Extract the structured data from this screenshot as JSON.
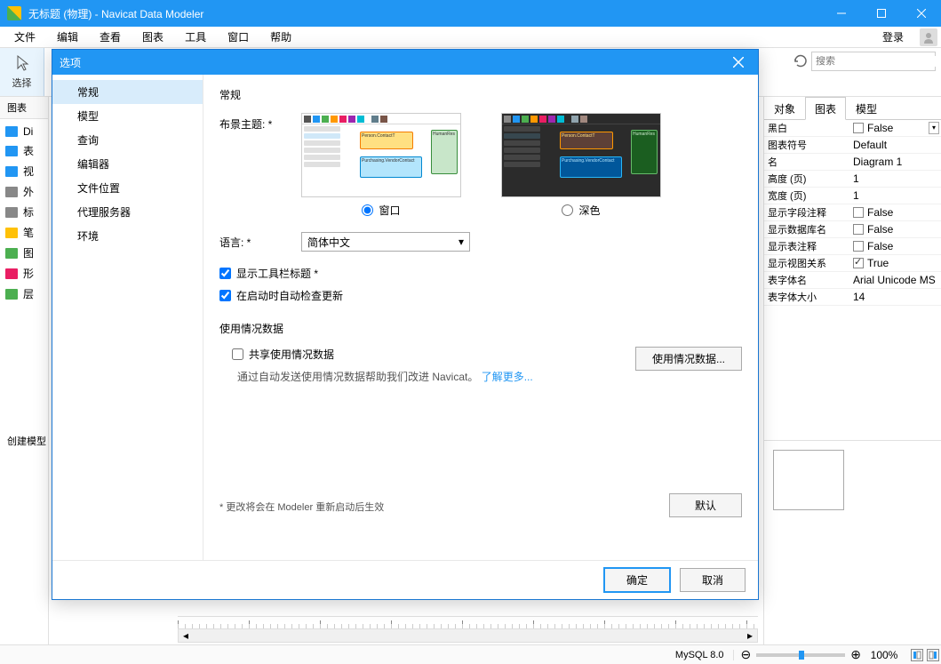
{
  "window": {
    "title": "无标题 (物理) - Navicat Data Modeler"
  },
  "menu": {
    "file": "文件",
    "edit": "编辑",
    "view": "查看",
    "diagram": "图表",
    "tools": "工具",
    "window": "窗口",
    "help": "帮助",
    "login": "登录"
  },
  "toolbar": {
    "select_label": "选择",
    "search_placeholder": "搜索"
  },
  "left_panel": {
    "tab": "图表",
    "items": [
      {
        "label": "Di",
        "color": "#2196F3"
      },
      {
        "label": "表",
        "color": "#2196F3"
      },
      {
        "label": "视",
        "color": "#2196F3"
      },
      {
        "label": "外",
        "color": "#888"
      },
      {
        "label": "标",
        "color": "#888"
      },
      {
        "label": "笔",
        "color": "#FFC107"
      },
      {
        "label": "图",
        "color": "#4CAF50"
      },
      {
        "label": "形",
        "color": "#E91E63"
      },
      {
        "label": "层",
        "color": "#4CAF50"
      }
    ],
    "create_model": "创建模型"
  },
  "right_panel": {
    "tabs": {
      "object": "对象",
      "diagram": "图表",
      "model": "模型"
    },
    "props": [
      {
        "key": "黑白",
        "val": "False",
        "cb": true,
        "checked": false,
        "dd": true
      },
      {
        "key": "图表符号",
        "val": "Default"
      },
      {
        "key": "名",
        "val": "Diagram 1"
      },
      {
        "key": "高度 (页)",
        "val": "1"
      },
      {
        "key": "宽度 (页)",
        "val": "1"
      },
      {
        "key": "显示字段注释",
        "val": "False",
        "cb": true,
        "checked": false
      },
      {
        "key": "显示数据库名",
        "val": "False",
        "cb": true,
        "checked": false
      },
      {
        "key": "显示表注释",
        "val": "False",
        "cb": true,
        "checked": false
      },
      {
        "key": "显示视图关系",
        "val": "True",
        "cb": true,
        "checked": true
      },
      {
        "key": "表字体名",
        "val": "Arial Unicode MS"
      },
      {
        "key": "表字体大小",
        "val": "14"
      }
    ]
  },
  "dialog": {
    "title": "选项",
    "nav": {
      "general": "常规",
      "model": "模型",
      "query": "查询",
      "editor": "编辑器",
      "file_loc": "文件位置",
      "proxy": "代理服务器",
      "env": "环境"
    },
    "general": {
      "heading": "常规",
      "theme_label": "布景主题: *",
      "theme_window": "窗口",
      "theme_dark": "深色",
      "lang_label": "语言: *",
      "lang_value": "简体中文",
      "show_toolbar_title": "显示工具栏标题 *",
      "auto_update": "在启动时自动检查更新",
      "usage_heading": "使用情况数据",
      "usage_button": "使用情况数据...",
      "share_usage": "共享使用情况数据",
      "usage_desc": "通过自动发送使用情况数据帮助我们改进 Navicat。 ",
      "learn_more": "了解更多...",
      "restart_note": "* 更改将会在 Modeler 重新启动后生效",
      "default_btn": "默认"
    },
    "footer": {
      "ok": "确定",
      "cancel": "取消"
    }
  },
  "statusbar": {
    "db": "MySQL 8.0",
    "zoom": "100%"
  }
}
